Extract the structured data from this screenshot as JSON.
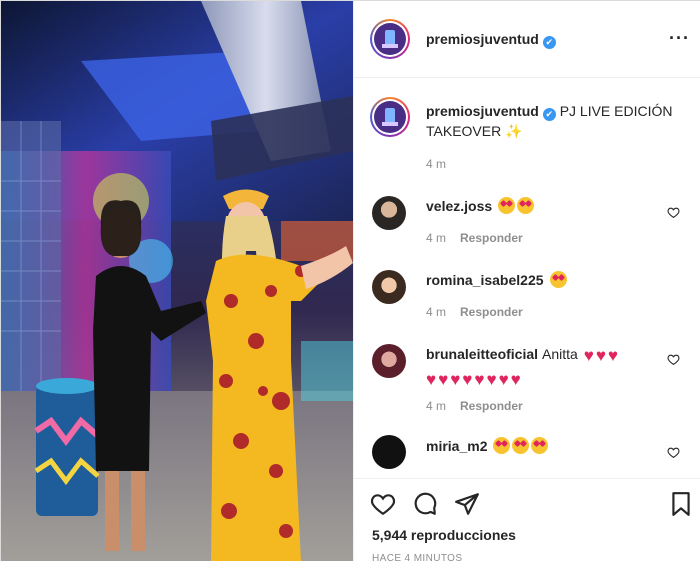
{
  "post": {
    "account": {
      "username": "premiosjuventud",
      "verified_glyph": "✔"
    },
    "more_icon": "more-options-icon",
    "more_label": "···"
  },
  "caption": {
    "username": "premiosjuventud",
    "text_line1": "PJ LIVE EDICIÓN",
    "text_line2": "TAKEOVER",
    "sparkle": "✨",
    "time": "4 m"
  },
  "comments": [
    {
      "username": "velez.joss",
      "text": "",
      "emojis": [
        "star-struck",
        "star-struck"
      ],
      "time": "4 m",
      "reply": "Responder"
    },
    {
      "username": "romina_isabel225",
      "text": "",
      "emojis": [
        "star-struck"
      ],
      "time": "4 m",
      "reply": "Responder"
    },
    {
      "username": "brunaleitteoficial",
      "text": "Anitta",
      "emojis": [
        "red-heart-x3",
        "red-heart-x8"
      ],
      "time": "4 m",
      "reply": "Responder"
    },
    {
      "username": "miria_m2",
      "text": "",
      "emojis": [
        "star-struck",
        "star-struck",
        "star-struck"
      ],
      "time": "",
      "reply": ""
    }
  ],
  "actions": {
    "like_icon": "heart-icon",
    "comment_icon": "comment-icon",
    "share_icon": "share-icon",
    "save_icon": "bookmark-icon"
  },
  "stats": {
    "views": "5,944 reproducciones",
    "posted": "HACE 4 MINUTOS"
  },
  "colors": {
    "accent_blue": "#3897f0",
    "heart_red": "#e0245e",
    "muted": "#8e8e8e"
  }
}
